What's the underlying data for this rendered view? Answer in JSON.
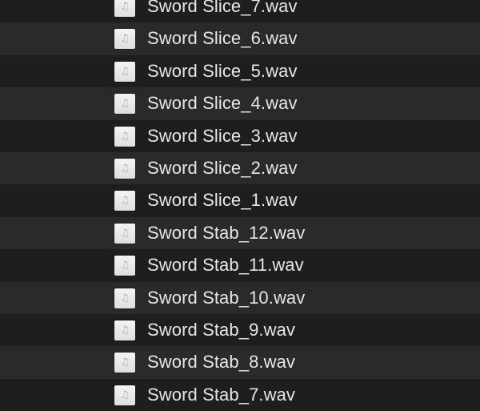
{
  "file_list": {
    "icon": "audio-file-icon",
    "items": [
      {
        "name": "Sword Slice_7.wav"
      },
      {
        "name": "Sword Slice_6.wav"
      },
      {
        "name": "Sword Slice_5.wav"
      },
      {
        "name": "Sword Slice_4.wav"
      },
      {
        "name": "Sword Slice_3.wav"
      },
      {
        "name": "Sword Slice_2.wav"
      },
      {
        "name": "Sword Slice_1.wav"
      },
      {
        "name": "Sword Stab_12.wav"
      },
      {
        "name": "Sword Stab_11.wav"
      },
      {
        "name": "Sword Stab_10.wav"
      },
      {
        "name": "Sword Stab_9.wav"
      },
      {
        "name": "Sword Stab_8.wav"
      },
      {
        "name": "Sword Stab_7.wav"
      }
    ]
  },
  "colors": {
    "background": "#1e1e1f",
    "row_alternate": "#2a2a2b",
    "text": "#e6e6e6"
  }
}
